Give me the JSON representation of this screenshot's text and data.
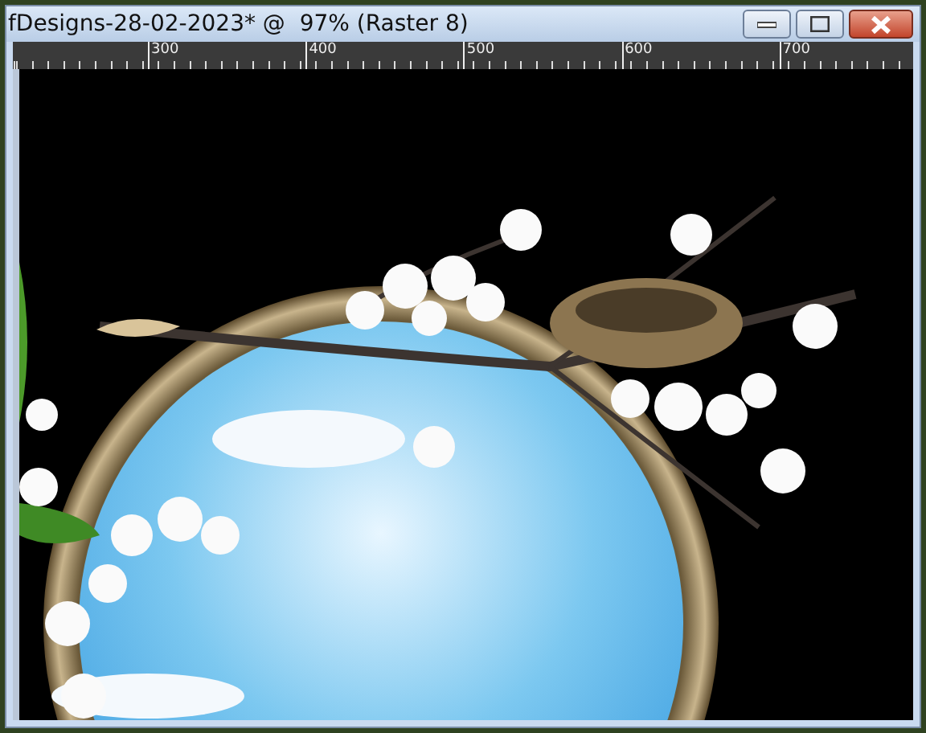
{
  "window": {
    "title": "fDesigns-28-02-2023* @  97% (Raster 8)"
  },
  "ruler": {
    "labels": [
      "300",
      "400",
      "500",
      "600",
      "700"
    ]
  }
}
